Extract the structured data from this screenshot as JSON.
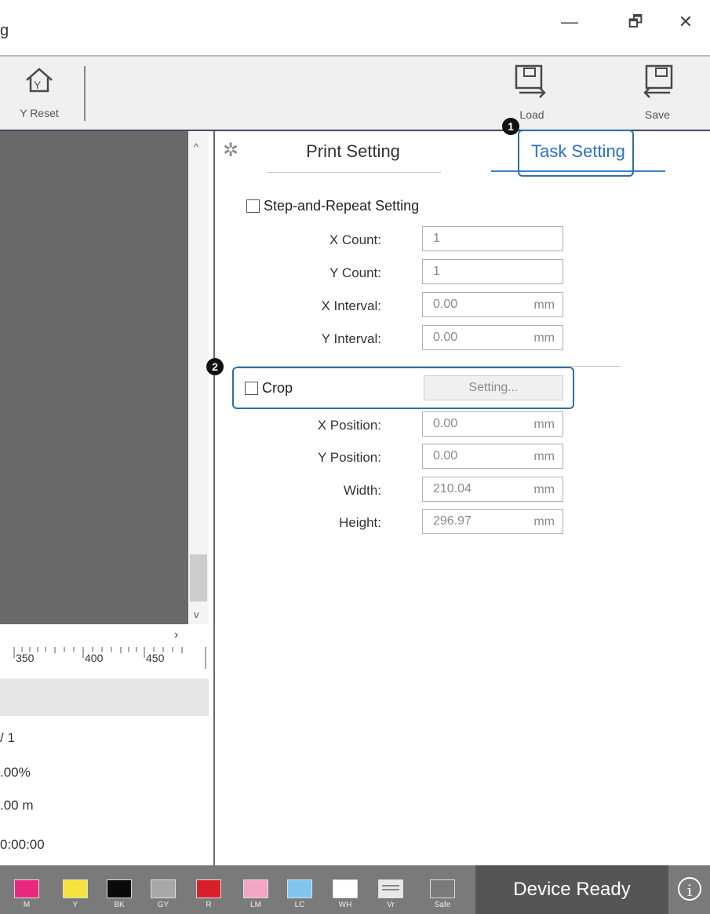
{
  "window": {
    "title_fragment": "g",
    "minimize_icon": "minimize-icon",
    "restore_icon": "restore-icon",
    "close_icon": "close-icon",
    "minimize_glyph": "—",
    "restore_glyph": "🗗",
    "close_glyph": "✕"
  },
  "toolbar": {
    "y_reset_label": "Y Reset",
    "load_label": "Load",
    "save_label": "Save"
  },
  "preview": {
    "ruler_ticks": [
      "350",
      "400",
      "450"
    ],
    "page_info": "/ 1",
    "percent": ".00%",
    "length": ".00 m",
    "time": "0:00:00"
  },
  "tabs": {
    "print_setting": "Print Setting",
    "task_setting": "Task Setting"
  },
  "step_repeat": {
    "label": "Step-and-Repeat Setting",
    "checked": false,
    "fields": [
      {
        "label": "X Count:",
        "value": "1",
        "unit": ""
      },
      {
        "label": "Y Count:",
        "value": "1",
        "unit": ""
      },
      {
        "label": "X Interval:",
        "value": "0.00",
        "unit": "mm"
      },
      {
        "label": "Y Interval:",
        "value": "0.00",
        "unit": "mm"
      }
    ]
  },
  "crop": {
    "label": "Crop",
    "checked": false,
    "setting_button": "Setting...",
    "fields": [
      {
        "label": "X Position:",
        "value": "0.00",
        "unit": "mm"
      },
      {
        "label": "Y Position:",
        "value": "0.00",
        "unit": "mm"
      },
      {
        "label": "Width:",
        "value": "210.04",
        "unit": "mm"
      },
      {
        "label": "Height:",
        "value": "296.97",
        "unit": "mm"
      }
    ]
  },
  "callouts": {
    "one": "1",
    "two": "2"
  },
  "status": {
    "inks": [
      {
        "label": "M",
        "color": "#e8287f"
      },
      {
        "label": "Y",
        "color": "#f5e23c"
      },
      {
        "label": "BK",
        "color": "#0a0a0a"
      },
      {
        "label": "GY",
        "color": "#a8a8a8"
      },
      {
        "label": "R",
        "color": "#d8202a"
      },
      {
        "label": "LM",
        "color": "#f2a6c2"
      },
      {
        "label": "LC",
        "color": "#7fc6ef"
      },
      {
        "label": "WH",
        "color": "#ffffff"
      },
      {
        "label": "Vr",
        "color": "#e8e8e8"
      },
      {
        "label": "Safe",
        "color": "#7a7a7a"
      }
    ],
    "device_state": "Device Ready",
    "info_glyph": "i"
  }
}
